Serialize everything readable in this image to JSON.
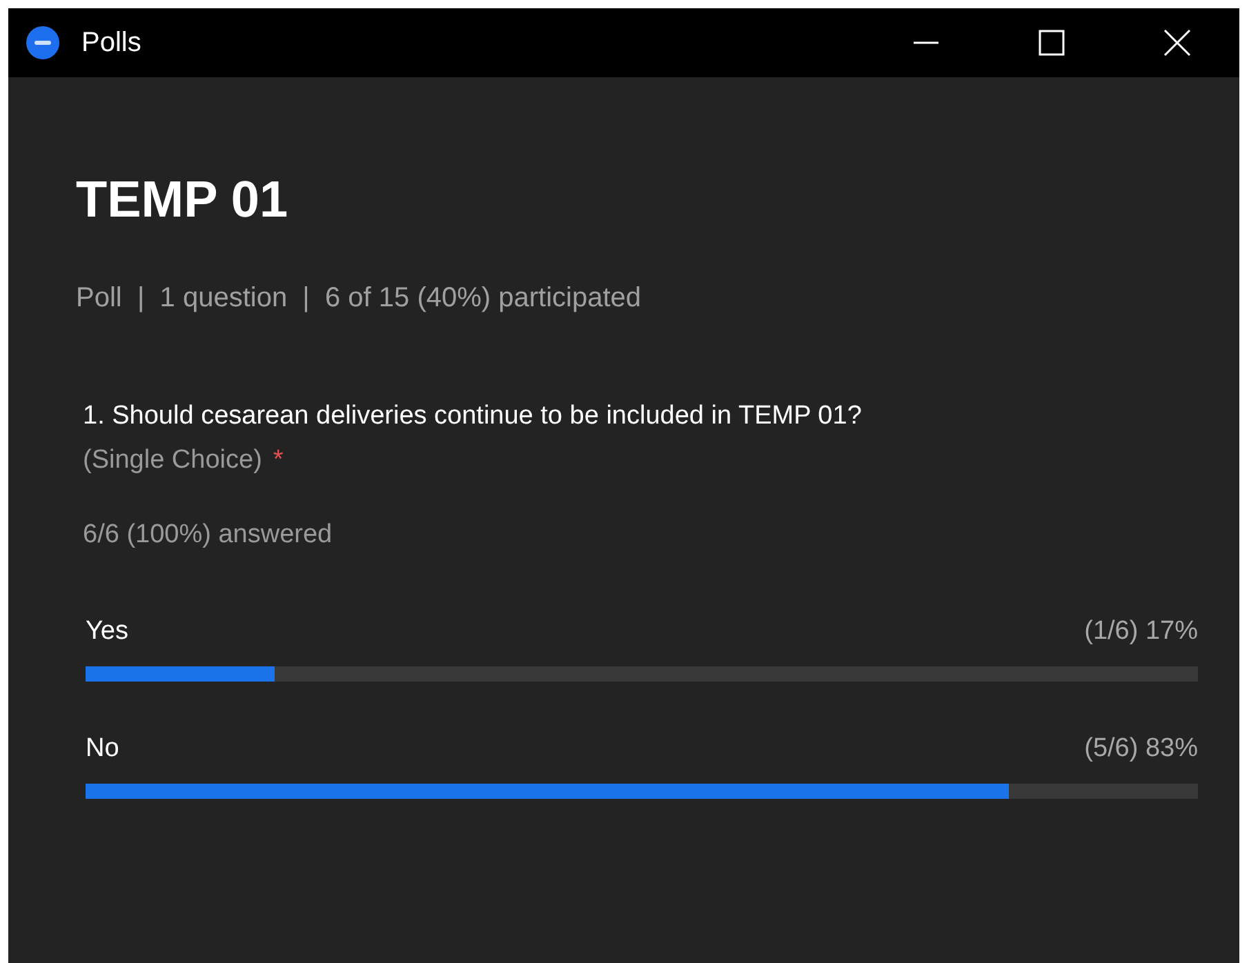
{
  "window": {
    "title": "Polls"
  },
  "poll": {
    "title": "TEMP 01",
    "meta": "Poll  |  1 question  |  6 of 15 (40%) participated"
  },
  "question": {
    "text": "1. Should cesarean deliveries continue to be included in TEMP 01?",
    "type": "(Single Choice)",
    "required_mark": "*",
    "answered": "6/6 (100%) answered",
    "options": [
      {
        "label": "Yes",
        "result": "(1/6) 17%",
        "level": 0.17
      },
      {
        "label": "No",
        "result": "(5/6) 83%",
        "level": 0.83
      }
    ]
  }
}
